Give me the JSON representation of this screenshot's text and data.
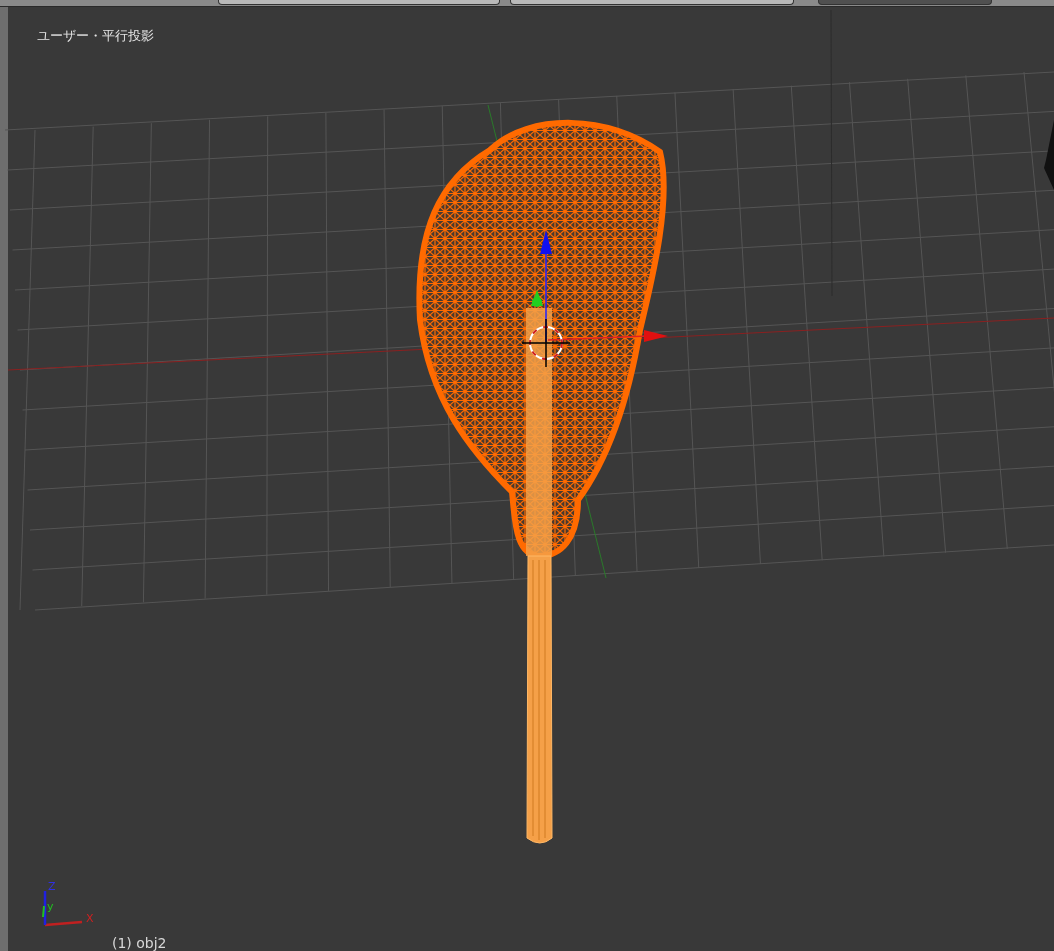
{
  "viewport": {
    "view_label": "ユーザー・平行投影",
    "object_label": "(1) obj2",
    "axis_labels": [
      {
        "kind": "z",
        "text": "Z"
      },
      {
        "kind": "y",
        "text": "y"
      },
      {
        "kind": "x",
        "text": "X"
      }
    ]
  }
}
